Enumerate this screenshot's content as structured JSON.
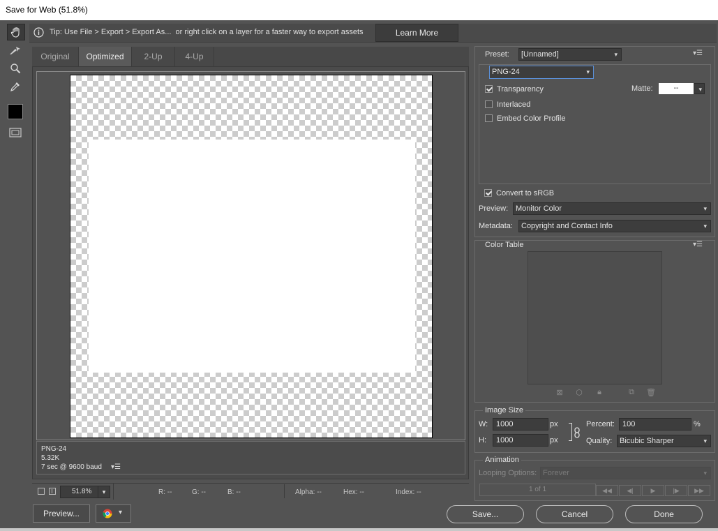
{
  "window": {
    "title": "Save for Web (51.8%)"
  },
  "tip": {
    "text": "Tip: Use File > Export > Export As...  or right click on a layer for a faster way to export assets",
    "learn_more": "Learn More"
  },
  "tools": [
    "hand-tool",
    "slice-select-tool",
    "zoom-tool",
    "eyedropper-tool",
    "eyedropper-color",
    "toggle-slices"
  ],
  "tabs": [
    {
      "label": "Original"
    },
    {
      "label": "Optimized",
      "active": true
    },
    {
      "label": "2-Up"
    },
    {
      "label": "4-Up"
    }
  ],
  "info": {
    "format": "PNG-24",
    "size": "5.32K",
    "time": "7 sec @ 9600 baud"
  },
  "status": {
    "zoom": "51.8%",
    "r": "R: --",
    "g": "G: --",
    "b": "B: --",
    "alpha": "Alpha: --",
    "hex": "Hex: --",
    "index": "Index: --"
  },
  "buttons": {
    "preview": "Preview...",
    "save": "Save...",
    "cancel": "Cancel",
    "done": "Done"
  },
  "settings": {
    "preset_label": "Preset:",
    "preset_value": "[Unnamed]",
    "format_value": "PNG-24",
    "transparency": {
      "label": "Transparency",
      "checked": true
    },
    "matte_label": "Matte:",
    "matte_value": "--",
    "interlaced": {
      "label": "Interlaced",
      "checked": false
    },
    "embed_profile": {
      "label": "Embed Color Profile",
      "checked": false
    },
    "convert_srgb": {
      "label": "Convert to sRGB",
      "checked": true
    },
    "preview_label": "Preview:",
    "preview_value": "Monitor Color",
    "metadata_label": "Metadata:",
    "metadata_value": "Copyright and Contact Info"
  },
  "color_table": {
    "title": "Color Table"
  },
  "image_size": {
    "title": "Image Size",
    "w_label": "W:",
    "w_value": "1000",
    "w_unit": "px",
    "h_label": "H:",
    "h_value": "1000",
    "h_unit": "px",
    "percent_label": "Percent:",
    "percent_value": "100",
    "percent_unit": "%",
    "quality_label": "Quality:",
    "quality_value": "Bicubic Sharper"
  },
  "animation": {
    "title": "Animation",
    "looping_label": "Looping Options:",
    "looping_value": "Forever",
    "frame_counter": "1 of 1"
  },
  "colors": {
    "background": "#535353",
    "panel_dark": "#3d3d3d",
    "title_bar": "#ffffff",
    "focus_border": "#5b8fd6"
  }
}
